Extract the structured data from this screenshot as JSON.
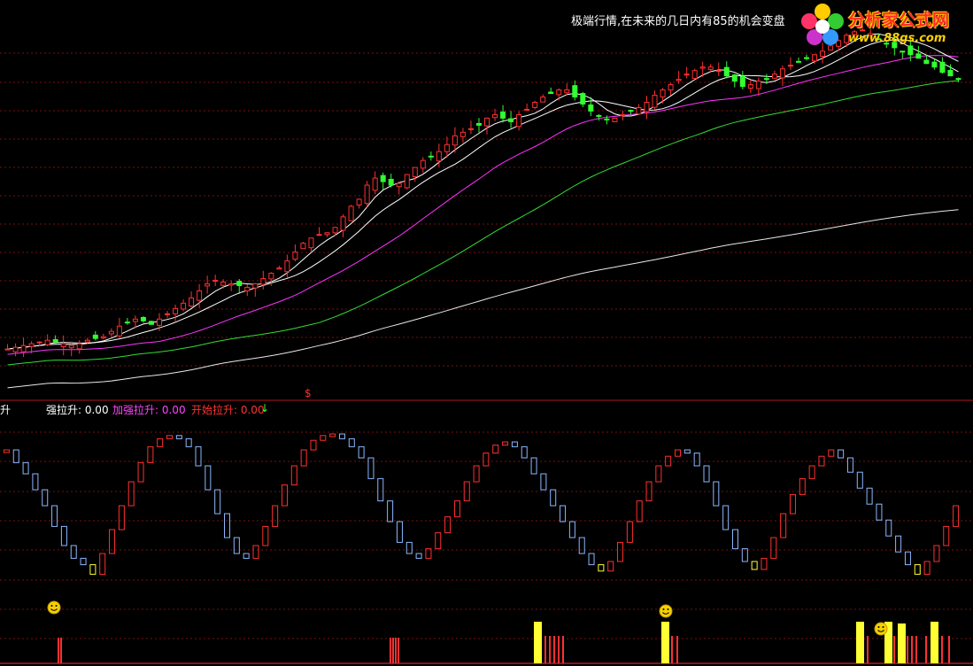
{
  "annotation": "极端行情,在未来的几日内有85的机会变盘",
  "logo": {
    "name": "分析家公式网",
    "url": "www.88gs.com"
  },
  "marker": "$",
  "legend": {
    "name_fragment": "升",
    "item1": "强拉升: 0.00",
    "item2": "加强拉升: 0.00",
    "item3": "开始拉升: 0.00",
    "arrow": "↓"
  },
  "colors": {
    "up": "#ff3030",
    "down": "#30ff30",
    "ma5": "#ffffff",
    "ma10": "#ffffff",
    "ma20": "#ff33ff",
    "ma40": "#33dd33",
    "ma120": "#e8e8e8",
    "grid": "#7a1010",
    "blue_box": "#8ab8ff",
    "red_box": "#ff3030",
    "yellow": "#ffff33",
    "legend_item1": "#ffffff",
    "legend_item2": "#ff44ff",
    "legend_item3": "#ff3333"
  },
  "chart_data": [
    {
      "type": "candlestick",
      "title": "",
      "ma_lines": [
        "ma5",
        "ma10",
        "ma20",
        "ma40",
        "ma120"
      ],
      "closes": [
        4.3,
        4.4,
        4.5,
        4.6,
        4.7,
        4.8,
        4.7,
        4.6,
        4.5,
        4.6,
        4.8,
        4.9,
        5.0,
        5.3,
        5.6,
        5.8,
        6.0,
        5.9,
        5.7,
        6.0,
        6.3,
        6.6,
        6.9,
        7.2,
        7.6,
        8.0,
        8.2,
        8.1,
        8.0,
        7.9,
        7.8,
        8.0,
        8.3,
        8.6,
        8.9,
        9.3,
        9.8,
        10.3,
        10.6,
        10.8,
        10.9,
        11.2,
        11.8,
        12.4,
        12.8,
        13.6,
        14.0,
        13.8,
        13.6,
        13.7,
        14.2,
        14.6,
        15.0,
        15.2,
        15.5,
        15.9,
        16.4,
        16.6,
        16.8,
        17.0,
        17.4,
        17.6,
        17.4,
        17.2,
        17.6,
        17.9,
        18.3,
        18.6,
        18.8,
        19.0,
        19.0,
        18.6,
        18.2,
        17.8,
        17.5,
        17.3,
        17.4,
        17.6,
        17.8,
        18.0,
        18.3,
        18.7,
        19.0,
        19.3,
        19.6,
        19.9,
        20.1,
        20.3,
        20.3,
        20.1,
        19.8,
        19.5,
        19.2,
        19.3,
        19.5,
        19.6,
        19.9,
        20.2,
        20.4,
        20.6,
        20.8,
        21.0,
        21.2,
        21.5,
        21.8,
        22.1,
        22.3,
        22.4,
        22.2,
        21.9,
        21.6,
        21.4,
        21.2,
        21.0,
        20.8,
        20.5,
        20.3,
        20.0,
        19.8,
        19.6
      ]
    },
    {
      "type": "bar",
      "title": "",
      "values": [
        0.9,
        0.82,
        0.75,
        0.65,
        0.55,
        0.42,
        0.3,
        0.22,
        0.18,
        0.12,
        0.25,
        0.4,
        0.55,
        0.7,
        0.82,
        0.92,
        0.97,
        0.99,
        0.97,
        0.92,
        0.8,
        0.65,
        0.5,
        0.35,
        0.25,
        0.22,
        0.3,
        0.42,
        0.55,
        0.68,
        0.8,
        0.9,
        0.96,
        0.99,
        1.0,
        0.97,
        0.92,
        0.85,
        0.72,
        0.58,
        0.45,
        0.32,
        0.25,
        0.22,
        0.28,
        0.38,
        0.48,
        0.58,
        0.7,
        0.8,
        0.88,
        0.93,
        0.95,
        0.92,
        0.85,
        0.75,
        0.65,
        0.55,
        0.45,
        0.35,
        0.25,
        0.18,
        0.14,
        0.2,
        0.32,
        0.45,
        0.58,
        0.7,
        0.8,
        0.86,
        0.9,
        0.88,
        0.8,
        0.7,
        0.55,
        0.4,
        0.28,
        0.2,
        0.15,
        0.22,
        0.35,
        0.5,
        0.62,
        0.72,
        0.8,
        0.86,
        0.9,
        0.85,
        0.76,
        0.66,
        0.56,
        0.46,
        0.36,
        0.26,
        0.18,
        0.12,
        0.2,
        0.3,
        0.42,
        0.55
      ]
    }
  ]
}
